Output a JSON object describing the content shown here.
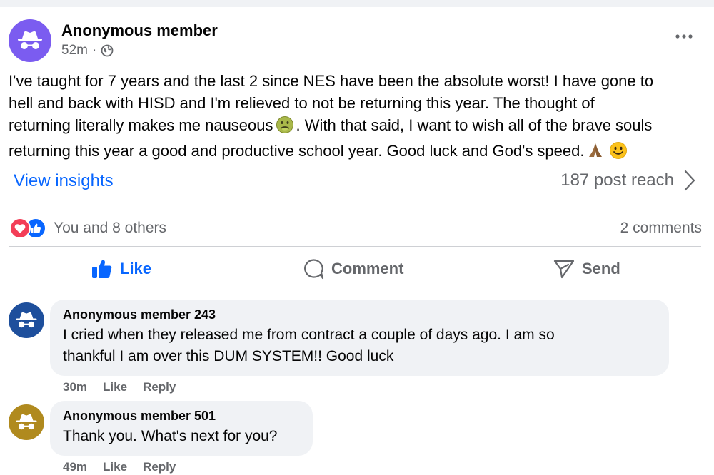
{
  "post": {
    "author": "Anonymous member",
    "time": "52m",
    "meta_separator": "·",
    "privacy_icon": "globe-icon",
    "text_lines": [
      "I've taught for 7 years and the last 2 since NES have been the absolute worst! I have gone to",
      "hell and back with HISD and I'm relieved to not be returning this year. The thought of",
      "returning literally makes me nauseous",
      ". With that said, I want to wish all of the brave souls",
      "returning this year a good and productive school year. Good luck and God's speed."
    ],
    "insights_label": "View insights",
    "reach_label": "187 post reach",
    "reactions_label": "You and 8 others",
    "comments_label": "2 comments",
    "avatar_color": "#7b5cf0"
  },
  "actions": {
    "like": "Like",
    "comment": "Comment",
    "send": "Send"
  },
  "comments": [
    {
      "author": "Anonymous member 243",
      "text_lines": [
        "I cried when they released me from contract a couple of days ago. I am so",
        "thankful I am over this DUM SYSTEM!! Good luck"
      ],
      "time": "30m",
      "like": "Like",
      "reply": "Reply",
      "avatar_color": "#1e4f9c"
    },
    {
      "author": "Anonymous member 501",
      "text_lines": [
        "Thank you. What's next for you?"
      ],
      "time": "49m",
      "like": "Like",
      "reply": "Reply",
      "avatar_color": "#b08a1e"
    }
  ],
  "colors": {
    "accent": "#0866ff",
    "secondary_text": "#65676b",
    "bubble": "#f0f2f5",
    "love": "#f33e58"
  }
}
